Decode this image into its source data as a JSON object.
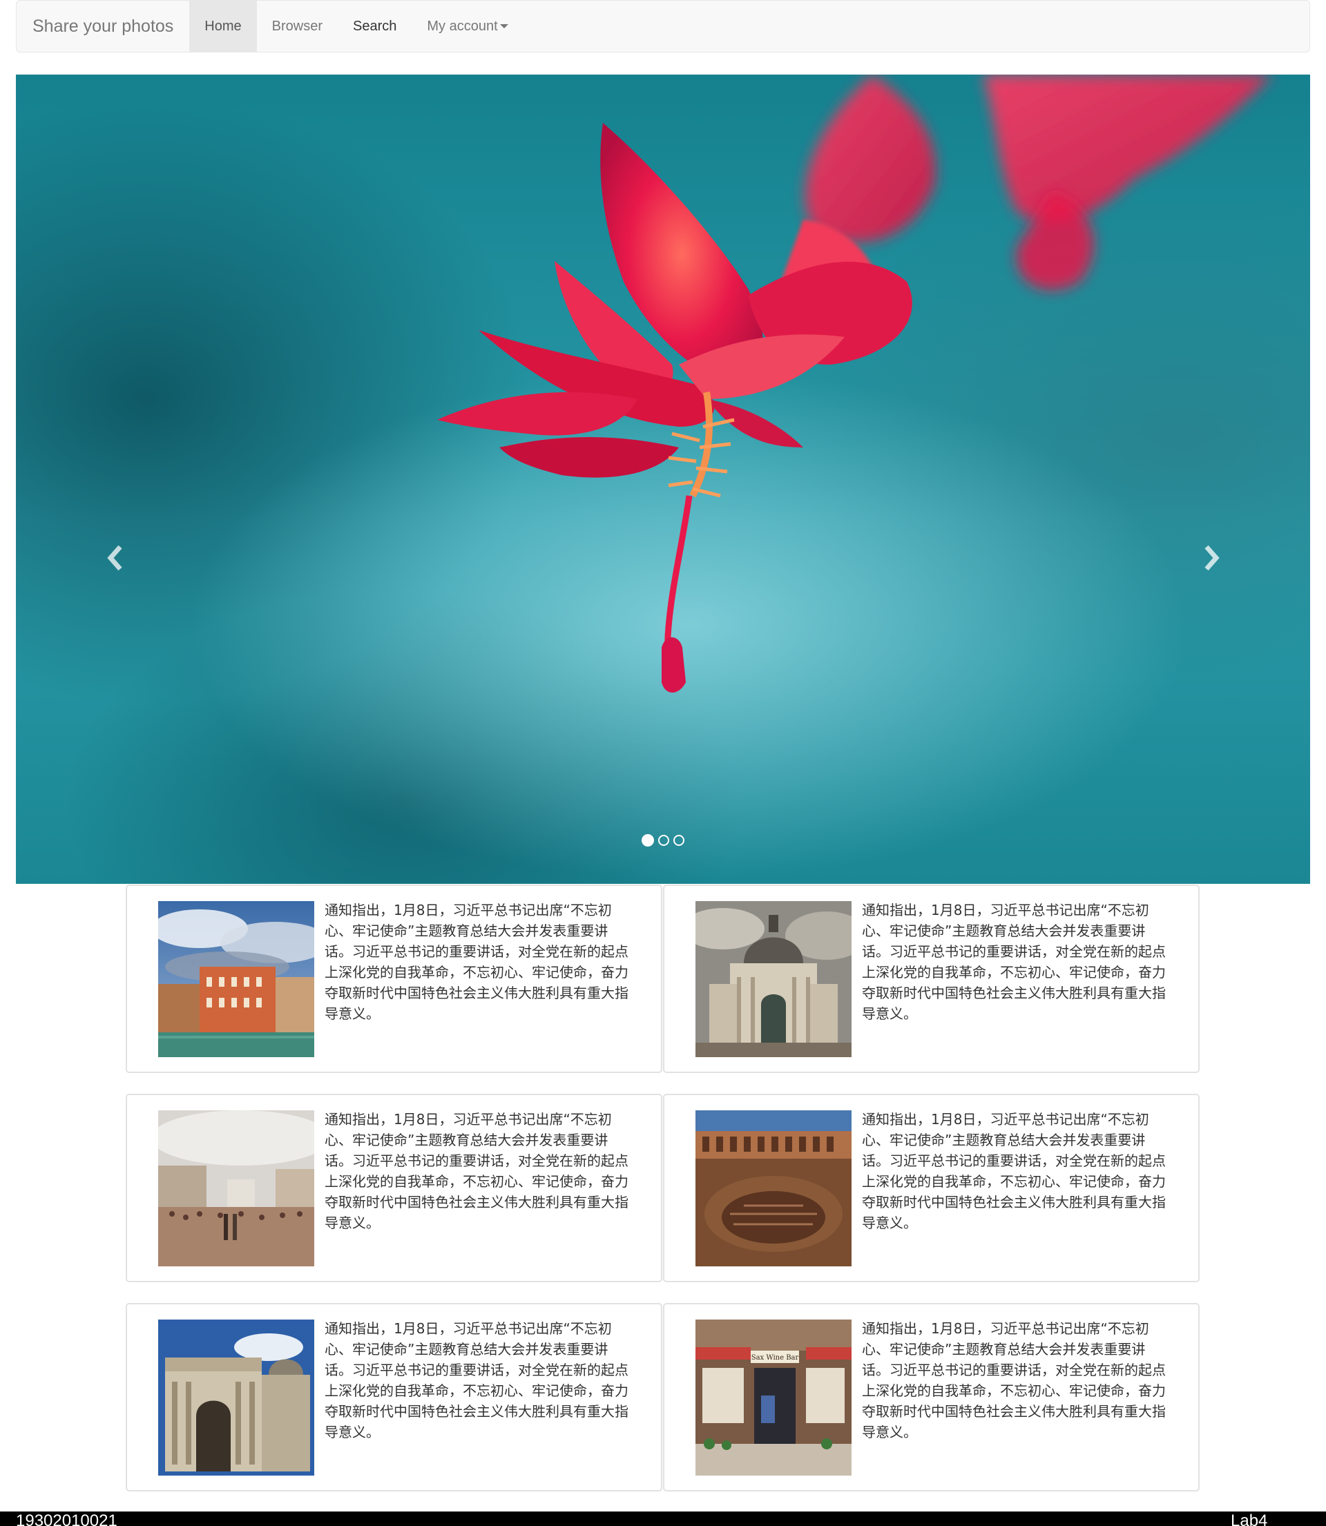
{
  "navbar": {
    "brand": "Share your photos",
    "items": [
      {
        "label": "Home",
        "active": true
      },
      {
        "label": "Browser",
        "active": false
      },
      {
        "label": "Search",
        "active": false
      },
      {
        "label": "My account",
        "active": false,
        "dropdown": true
      }
    ]
  },
  "carousel": {
    "slide_count": 3,
    "active_index": 0,
    "prev_icon": "chevron-left-icon",
    "next_icon": "chevron-right-icon"
  },
  "cards": [
    {
      "image": "venice-canal-palazzo",
      "text": "通知指出，1月8日，习近平总书记出席“不忘初心、牢记使命”主题教育总结大会并发表重要讲话。习近平总书记的重要讲话，对全党在新的起点上深化党的自我革命，不忘初心、牢记使命，奋力夺取新时代中国特色社会主义伟大胜利具有重大指导意义。"
    },
    {
      "image": "baroque-domed-church",
      "text": "通知指出，1月8日，习近平总书记出席“不忘初心、牢记使命”主题教育总结大会并发表重要讲话。习近平总书记的重要讲话，对全党在新的起点上深化党的自我革命，不忘初心、牢记使命，奋力夺取新时代中国特色社会主义伟大胜利具有重大指导意义。"
    },
    {
      "image": "crowded-piazza",
      "text": "通知指出，1月8日，习近平总书记出席“不忘初心、牢记使命”主题教育总结大会并发表重要讲话。习近平总书记的重要讲话，对全党在新的起点上深化党的自我革命，不忘初心、牢记使命，奋力夺取新时代中国特色社会主义伟大胜利具有重大指导意义。"
    },
    {
      "image": "colosseum-interior",
      "text": "通知指出，1月8日，习近平总书记出席“不忘初心、牢记使命”主题教育总结大会并发表重要讲话。习近平总书记的重要讲话，对全党在新的起点上深化党的自我革命，不忘初心、牢记使命，奋力夺取新时代中国特色社会主义伟大胜利具有重大指导意义。"
    },
    {
      "image": "roman-triumphal-arch",
      "text": "通知指出，1月8日，习近平总书记出席“不忘初心、牢记使命”主题教育总结大会并发表重要讲话。习近平总书记的重要讲话，对全党在新的起点上深化党的自我革命，不忘初心、牢记使命，奋力夺取新时代中国特色社会主义伟大胜利具有重大指导意义。"
    },
    {
      "image": "wine-bar-storefront",
      "sign": "Sax Wine Bar",
      "text": "通知指出，1月8日，习近平总书记出席“不忘初心、牢记使命”主题教育总结大会并发表重要讲话。习近平总书记的重要讲话，对全党在新的起点上深化党的自我革命，不忘初心、牢记使命，奋力夺取新时代中国特色社会主义伟大胜利具有重大指导意义。"
    }
  ],
  "footer": {
    "left": "19302010021",
    "right": "Lab4"
  },
  "colors": {
    "navbar_bg": "#f8f8f8",
    "nav_active_bg": "#e7e7e7",
    "carousel_teal": "#1e8a97",
    "flower_red": "#e8194a",
    "footer_bg": "#000000"
  }
}
